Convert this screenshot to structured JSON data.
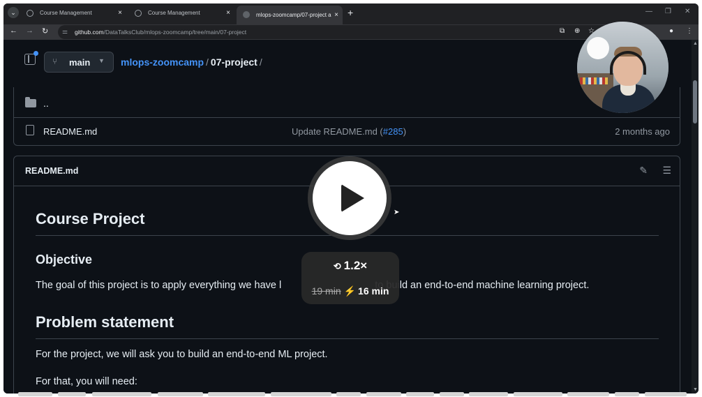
{
  "browser": {
    "tabs": [
      {
        "label": "Course Management",
        "active": false
      },
      {
        "label": "Course Management",
        "active": false
      },
      {
        "label": "mlops-zoomcamp/07-project a",
        "active": true
      }
    ],
    "close_glyph": "×",
    "new_tab_glyph": "+",
    "url_host": "github.com",
    "url_path": "/DataTalksClub/mlops-zoomcamp/tree/main/07-project"
  },
  "repo": {
    "branch": "main",
    "breadcrumb": {
      "repo": "mlops-zoomcamp",
      "folder": "07-project",
      "separator": "/"
    }
  },
  "files": [
    {
      "name": "..",
      "type": "parent-directory"
    },
    {
      "name": "README.md",
      "type": "file",
      "commit_message": "Update README.md (",
      "commit_link": "#285",
      "commit_close": ")",
      "updated": "2 months ago"
    }
  ],
  "readme": {
    "header_title": "README.md",
    "h1": "Course Project",
    "objective_heading": "Objective",
    "objective_text_start": "The goal of this project is to apply everything we have l",
    "objective_text_end": " to build an end-to-end machine learning project.",
    "problem_heading": "Problem statement",
    "problem_text": "For the project, we will ask you to build an end-to-end ML project.",
    "need_text": "For that, you will need:"
  },
  "player": {
    "speed": "1.2×",
    "original_duration": "19 min",
    "new_duration": "16 min"
  },
  "colors": {
    "bg": "#0d1117",
    "border": "#3d444d",
    "link": "#4493f8",
    "text": "#e6edf3",
    "muted": "#9198a1"
  },
  "icons": [
    "chevron-down-icon",
    "globe-icon",
    "close-icon",
    "plus-icon",
    "back-icon",
    "forward-icon",
    "reload-icon",
    "tune-icon",
    "cast-icon",
    "zoom-icon",
    "star-icon",
    "profile-icon",
    "more-icon",
    "sidebar-toggle-icon",
    "branch-icon",
    "folder-icon",
    "file-icon",
    "pencil-icon",
    "list-icon",
    "play-icon",
    "speed-icon",
    "bolt-icon",
    "cursor-icon"
  ]
}
